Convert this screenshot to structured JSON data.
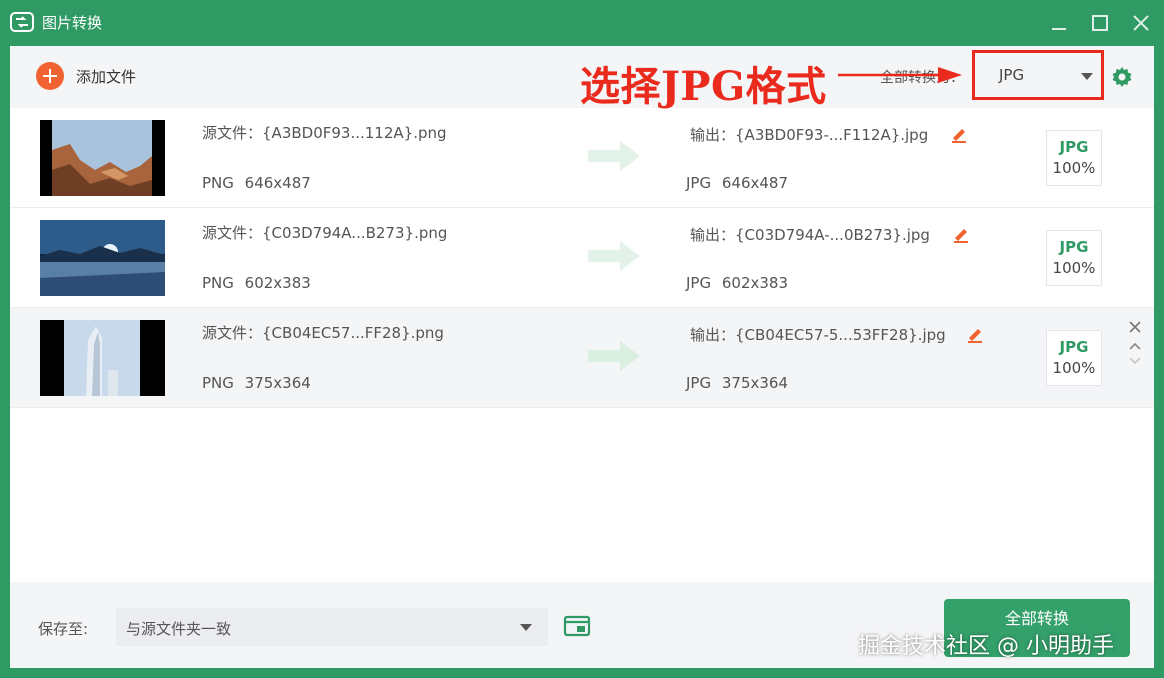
{
  "app": {
    "title": "图片转换",
    "icon": "image-convert-app-icon",
    "controls": [
      "minimize-icon",
      "maximize-icon",
      "close-icon"
    ]
  },
  "toolbar": {
    "add_label": "添加文件",
    "convert_all_label": "全部转换为：",
    "format_value": "JPG",
    "settings_icon": "gear-icon"
  },
  "annotation": {
    "text": "选择JPG格式",
    "color": "#ea2a1c"
  },
  "files": [
    {
      "source_label": "源文件：",
      "source_name": "{A3BD0F93...112A}.png",
      "source_format": "PNG",
      "source_size": "646x487",
      "output_label": "输出：",
      "output_name": "{A3BD0F93-...F112A}.jpg",
      "output_format": "JPG",
      "output_size": "646x487",
      "badge_format": "JPG",
      "badge_quality": "100%",
      "thumb": "canyon-landscape-photo"
    },
    {
      "source_label": "源文件：",
      "source_name": "{C03D794A...B273}.png",
      "source_format": "PNG",
      "source_size": "602x383",
      "output_label": "输出：",
      "output_name": "{C03D794A-...0B273}.jpg",
      "output_format": "JPG",
      "output_size": "602x383",
      "badge_format": "JPG",
      "badge_quality": "100%",
      "thumb": "frozen-lake-sunrise-photo"
    },
    {
      "source_label": "源文件：",
      "source_name": "{CB04EC57...FF28}.png",
      "source_format": "PNG",
      "source_size": "375x364",
      "output_label": "输出：",
      "output_name": "{CB04EC57-5...53FF28}.jpg",
      "output_format": "JPG",
      "output_size": "375x364",
      "badge_format": "JPG",
      "badge_quality": "100%",
      "thumb": "skyscraper-photo"
    }
  ],
  "footer": {
    "save_label": "保存至:",
    "save_path": "与源文件夹一致",
    "folder_icon": "folder-open-icon",
    "convert_button": "全部转换"
  },
  "watermark": "掘金技术社区 @ 小明助手",
  "colors": {
    "brand_green": "#2f9a63",
    "add_orange": "#f06331",
    "highlight_red": "#ea2a1c"
  }
}
